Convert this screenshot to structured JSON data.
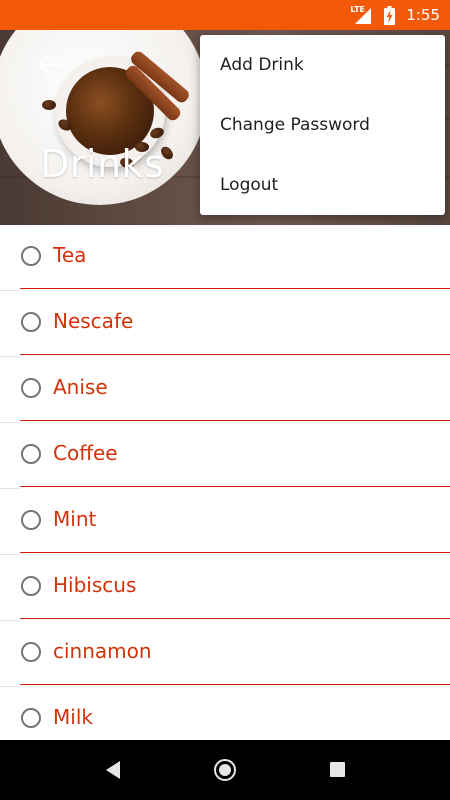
{
  "status_bar": {
    "network": "LTE",
    "time": "1:55",
    "background_color": "#f25a0a"
  },
  "header": {
    "title": "Drinks",
    "back_icon": "arrow-left-icon"
  },
  "overflow_menu": {
    "items": [
      {
        "label": "Add Drink"
      },
      {
        "label": "Change Password"
      },
      {
        "label": "Logout"
      }
    ]
  },
  "drinks": {
    "accent_color": "#d3330a",
    "items": [
      {
        "label": "Tea",
        "selected": false
      },
      {
        "label": "Nescafe",
        "selected": false
      },
      {
        "label": "Anise",
        "selected": false
      },
      {
        "label": "Coffee",
        "selected": false
      },
      {
        "label": "Mint",
        "selected": false
      },
      {
        "label": "Hibiscus",
        "selected": false
      },
      {
        "label": "cinnamon",
        "selected": false
      },
      {
        "label": "Milk",
        "selected": false
      }
    ]
  },
  "nav_bar": {
    "buttons": [
      "back-icon",
      "home-icon",
      "recents-icon"
    ]
  }
}
